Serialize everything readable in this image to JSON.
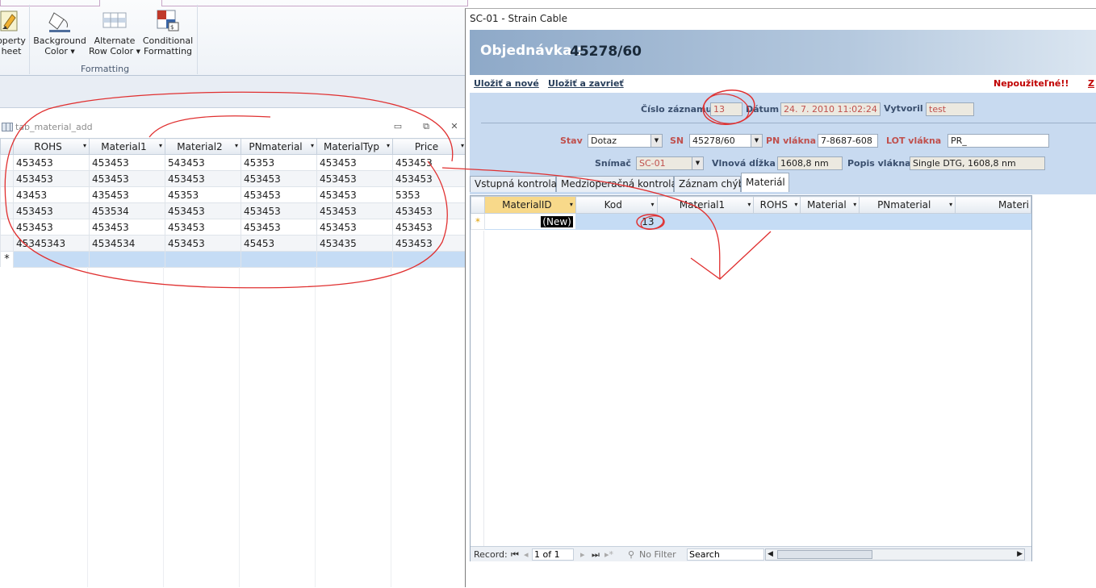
{
  "ribbon": {
    "buttons": [
      {
        "line1": "operty",
        "line2": "heet"
      },
      {
        "line1": "Background",
        "line2": "Color"
      },
      {
        "line1": "Alternate",
        "line2": "Row Color"
      },
      {
        "line1": "Conditional",
        "line2": "Formatting"
      }
    ],
    "group_label": "Formatting"
  },
  "datasheet": {
    "title": "tab_material_add",
    "columns": [
      "ROHS",
      "Material1",
      "Material2",
      "PNmaterial",
      "MaterialTyp",
      "Price"
    ],
    "rows": [
      [
        "453453",
        "453453",
        "543453",
        "45353",
        "453453",
        "453453"
      ],
      [
        "453453",
        "453453",
        "453453",
        "453453",
        "453453",
        "453453"
      ],
      [
        "43453",
        "435453",
        "45353",
        "453453",
        "453453",
        "5353"
      ],
      [
        "453453",
        "453534",
        "453453",
        "453453",
        "453453",
        "453453"
      ],
      [
        "453453",
        "453453",
        "453453",
        "453453",
        "453453",
        "453453"
      ],
      [
        "45345343",
        "4534534",
        "453453",
        "45453",
        "453435",
        "453453"
      ]
    ],
    "new_row_marker": "*"
  },
  "form": {
    "window_title": "SC-01 - Strain Cable",
    "header_label": "Objednávka :",
    "header_value": "45278/60",
    "actions": {
      "save_new": "Uložiť a nové",
      "save_close": "Uložiť a zavrieť",
      "unusable": "Nepoužiteľné!!",
      "z": "Z"
    },
    "fields": {
      "record_no_label": "Číslo záznamu",
      "record_no_value": "13",
      "date_label": "Dátum",
      "date_value": "24. 7. 2010 11:02:24",
      "created_by_label": "Vytvoril",
      "created_by_value": "test",
      "status_label": "Stav",
      "status_value": "Dotaz",
      "sn_label": "SN",
      "sn_value": "45278/60",
      "pn_fiber_label": "PN vlákna",
      "pn_fiber_value": "7-8687-608",
      "lot_fiber_label": "LOT vlákna",
      "lot_fiber_value": "PR_",
      "sensor_label": "Snímač",
      "sensor_value": "SC-01",
      "wavelength_label": "Vlnová dĺžka",
      "wavelength_value": "1608,8 nm",
      "fiber_desc_label": "Popis vlákna",
      "fiber_desc_value": "Single DTG, 1608,8 nm"
    },
    "tabs": [
      "Vstupná kontrola",
      "Medzioperačná kontrola",
      "Záznam chýb",
      "Materiál"
    ],
    "subform": {
      "columns": [
        "MaterialID",
        "Kod",
        "Material1",
        "ROHS",
        "Material",
        "PNmaterial",
        "Materi"
      ],
      "new_row": {
        "marker": "*",
        "material_id": "(New)",
        "kod": "13"
      }
    },
    "navbar": {
      "record_label": "Record:",
      "position": "1 of 1",
      "filter": "No Filter",
      "search": "Search"
    }
  }
}
